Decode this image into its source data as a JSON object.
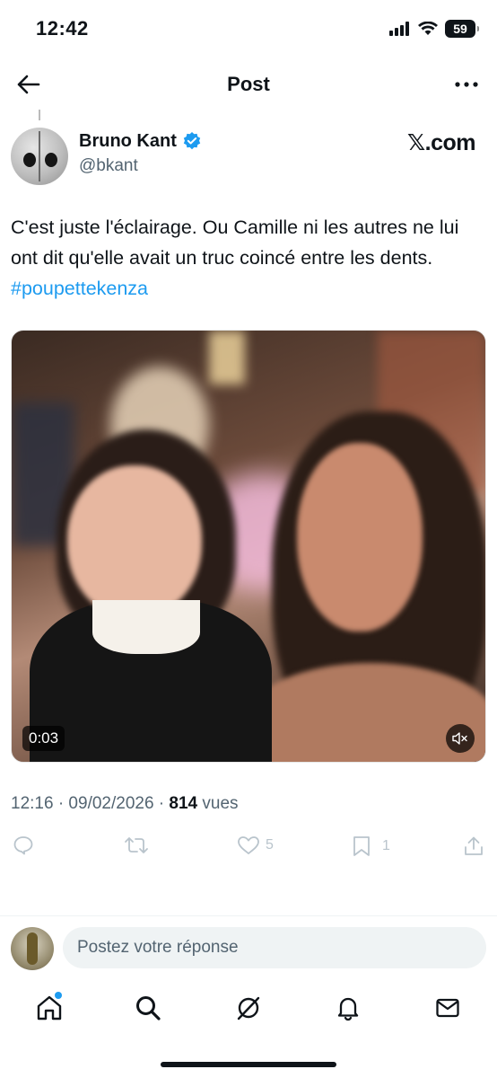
{
  "status_bar": {
    "time": "12:42",
    "battery": "59"
  },
  "header": {
    "title": "Post"
  },
  "author": {
    "name": "Bruno Kant",
    "handle": "@bkant",
    "source": "𝕏.com"
  },
  "post": {
    "text": "C'est juste l'éclairage. Ou Camille ni les autres ne lui ont dit qu'elle avait un truc coincé entre les dents. ",
    "hashtag": "#poupettekenza",
    "video_duration": "0:03"
  },
  "meta": {
    "datetime": "12:16 · 09/02/2026 · ",
    "views_count": "814",
    "views_label": " vues"
  },
  "actions": {
    "likes": "5",
    "bookmarks": "1"
  },
  "reply": {
    "placeholder": "Postez votre réponse"
  },
  "colors": {
    "accent": "#1d9bf0",
    "text": "#0f1419",
    "muted": "#536471"
  }
}
